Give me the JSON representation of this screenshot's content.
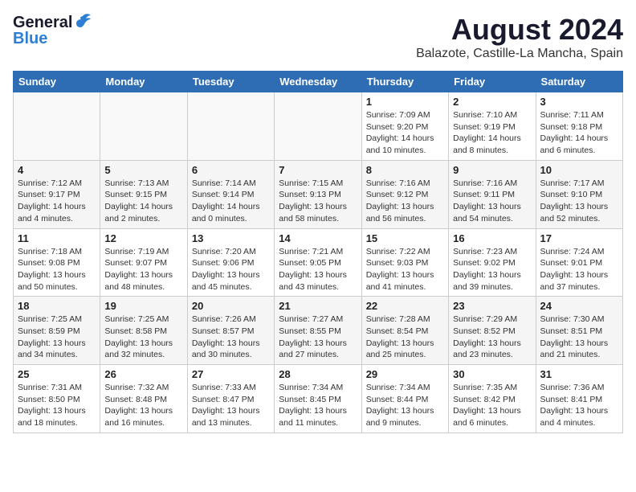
{
  "header": {
    "logo_general": "General",
    "logo_blue": "Blue",
    "title": "August 2024",
    "subtitle": "Balazote, Castille-La Mancha, Spain"
  },
  "calendar": {
    "headers": [
      "Sunday",
      "Monday",
      "Tuesday",
      "Wednesday",
      "Thursday",
      "Friday",
      "Saturday"
    ],
    "weeks": [
      [
        {
          "day": "",
          "info": ""
        },
        {
          "day": "",
          "info": ""
        },
        {
          "day": "",
          "info": ""
        },
        {
          "day": "",
          "info": ""
        },
        {
          "day": "1",
          "info": "Sunrise: 7:09 AM\nSunset: 9:20 PM\nDaylight: 14 hours\nand 10 minutes."
        },
        {
          "day": "2",
          "info": "Sunrise: 7:10 AM\nSunset: 9:19 PM\nDaylight: 14 hours\nand 8 minutes."
        },
        {
          "day": "3",
          "info": "Sunrise: 7:11 AM\nSunset: 9:18 PM\nDaylight: 14 hours\nand 6 minutes."
        }
      ],
      [
        {
          "day": "4",
          "info": "Sunrise: 7:12 AM\nSunset: 9:17 PM\nDaylight: 14 hours\nand 4 minutes."
        },
        {
          "day": "5",
          "info": "Sunrise: 7:13 AM\nSunset: 9:15 PM\nDaylight: 14 hours\nand 2 minutes."
        },
        {
          "day": "6",
          "info": "Sunrise: 7:14 AM\nSunset: 9:14 PM\nDaylight: 14 hours\nand 0 minutes."
        },
        {
          "day": "7",
          "info": "Sunrise: 7:15 AM\nSunset: 9:13 PM\nDaylight: 13 hours\nand 58 minutes."
        },
        {
          "day": "8",
          "info": "Sunrise: 7:16 AM\nSunset: 9:12 PM\nDaylight: 13 hours\nand 56 minutes."
        },
        {
          "day": "9",
          "info": "Sunrise: 7:16 AM\nSunset: 9:11 PM\nDaylight: 13 hours\nand 54 minutes."
        },
        {
          "day": "10",
          "info": "Sunrise: 7:17 AM\nSunset: 9:10 PM\nDaylight: 13 hours\nand 52 minutes."
        }
      ],
      [
        {
          "day": "11",
          "info": "Sunrise: 7:18 AM\nSunset: 9:08 PM\nDaylight: 13 hours\nand 50 minutes."
        },
        {
          "day": "12",
          "info": "Sunrise: 7:19 AM\nSunset: 9:07 PM\nDaylight: 13 hours\nand 48 minutes."
        },
        {
          "day": "13",
          "info": "Sunrise: 7:20 AM\nSunset: 9:06 PM\nDaylight: 13 hours\nand 45 minutes."
        },
        {
          "day": "14",
          "info": "Sunrise: 7:21 AM\nSunset: 9:05 PM\nDaylight: 13 hours\nand 43 minutes."
        },
        {
          "day": "15",
          "info": "Sunrise: 7:22 AM\nSunset: 9:03 PM\nDaylight: 13 hours\nand 41 minutes."
        },
        {
          "day": "16",
          "info": "Sunrise: 7:23 AM\nSunset: 9:02 PM\nDaylight: 13 hours\nand 39 minutes."
        },
        {
          "day": "17",
          "info": "Sunrise: 7:24 AM\nSunset: 9:01 PM\nDaylight: 13 hours\nand 37 minutes."
        }
      ],
      [
        {
          "day": "18",
          "info": "Sunrise: 7:25 AM\nSunset: 8:59 PM\nDaylight: 13 hours\nand 34 minutes."
        },
        {
          "day": "19",
          "info": "Sunrise: 7:25 AM\nSunset: 8:58 PM\nDaylight: 13 hours\nand 32 minutes."
        },
        {
          "day": "20",
          "info": "Sunrise: 7:26 AM\nSunset: 8:57 PM\nDaylight: 13 hours\nand 30 minutes."
        },
        {
          "day": "21",
          "info": "Sunrise: 7:27 AM\nSunset: 8:55 PM\nDaylight: 13 hours\nand 27 minutes."
        },
        {
          "day": "22",
          "info": "Sunrise: 7:28 AM\nSunset: 8:54 PM\nDaylight: 13 hours\nand 25 minutes."
        },
        {
          "day": "23",
          "info": "Sunrise: 7:29 AM\nSunset: 8:52 PM\nDaylight: 13 hours\nand 23 minutes."
        },
        {
          "day": "24",
          "info": "Sunrise: 7:30 AM\nSunset: 8:51 PM\nDaylight: 13 hours\nand 21 minutes."
        }
      ],
      [
        {
          "day": "25",
          "info": "Sunrise: 7:31 AM\nSunset: 8:50 PM\nDaylight: 13 hours\nand 18 minutes."
        },
        {
          "day": "26",
          "info": "Sunrise: 7:32 AM\nSunset: 8:48 PM\nDaylight: 13 hours\nand 16 minutes."
        },
        {
          "day": "27",
          "info": "Sunrise: 7:33 AM\nSunset: 8:47 PM\nDaylight: 13 hours\nand 13 minutes."
        },
        {
          "day": "28",
          "info": "Sunrise: 7:34 AM\nSunset: 8:45 PM\nDaylight: 13 hours\nand 11 minutes."
        },
        {
          "day": "29",
          "info": "Sunrise: 7:34 AM\nSunset: 8:44 PM\nDaylight: 13 hours\nand 9 minutes."
        },
        {
          "day": "30",
          "info": "Sunrise: 7:35 AM\nSunset: 8:42 PM\nDaylight: 13 hours\nand 6 minutes."
        },
        {
          "day": "31",
          "info": "Sunrise: 7:36 AM\nSunset: 8:41 PM\nDaylight: 13 hours\nand 4 minutes."
        }
      ]
    ]
  }
}
